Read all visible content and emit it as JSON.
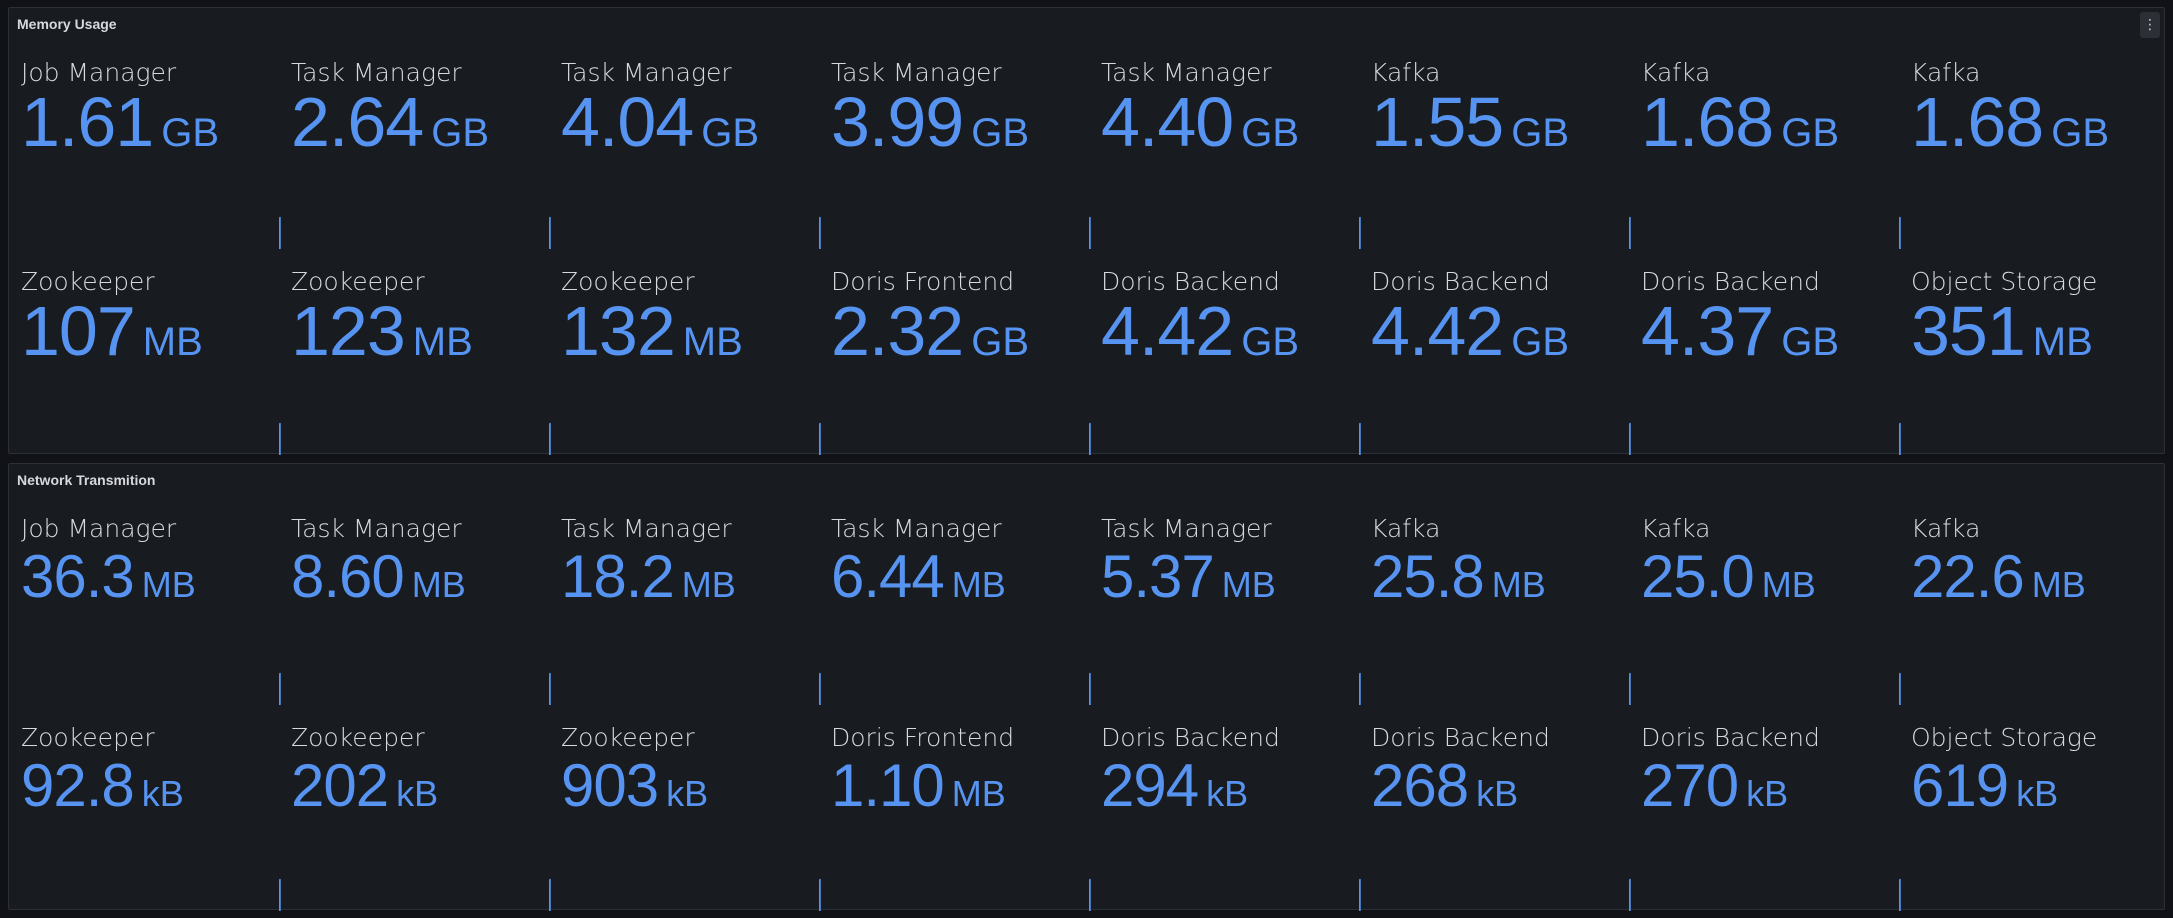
{
  "colors": {
    "value": "#5794f2",
    "background": "#111217",
    "panel": "#181b1f"
  },
  "memory": {
    "title": "Memory Usage",
    "menu_icon": "vertical-ellipsis-icon",
    "stats": [
      {
        "label": "Job Manager",
        "value": "1.61",
        "unit": "GB"
      },
      {
        "label": "Task Manager",
        "value": "2.64",
        "unit": "GB"
      },
      {
        "label": "Task Manager",
        "value": "4.04",
        "unit": "GB"
      },
      {
        "label": "Task Manager",
        "value": "3.99",
        "unit": "GB"
      },
      {
        "label": "Task Manager",
        "value": "4.40",
        "unit": "GB"
      },
      {
        "label": "Kafka",
        "value": "1.55",
        "unit": "GB"
      },
      {
        "label": "Kafka",
        "value": "1.68",
        "unit": "GB"
      },
      {
        "label": "Kafka",
        "value": "1.68",
        "unit": "GB"
      },
      {
        "label": "Zookeeper",
        "value": "107",
        "unit": "MB"
      },
      {
        "label": "Zookeeper",
        "value": "123",
        "unit": "MB"
      },
      {
        "label": "Zookeeper",
        "value": "132",
        "unit": "MB"
      },
      {
        "label": "Doris Frontend",
        "value": "2.32",
        "unit": "GB"
      },
      {
        "label": "Doris Backend",
        "value": "4.42",
        "unit": "GB"
      },
      {
        "label": "Doris Backend",
        "value": "4.42",
        "unit": "GB"
      },
      {
        "label": "Doris Backend",
        "value": "4.37",
        "unit": "GB"
      },
      {
        "label": "Object Storage",
        "value": "351",
        "unit": "MB"
      }
    ]
  },
  "network": {
    "title": "Network Transmition",
    "stats": [
      {
        "label": "Job Manager",
        "value": "36.3",
        "unit": "MB"
      },
      {
        "label": "Task Manager",
        "value": "8.60",
        "unit": "MB"
      },
      {
        "label": "Task Manager",
        "value": "18.2",
        "unit": "MB"
      },
      {
        "label": "Task Manager",
        "value": "6.44",
        "unit": "MB"
      },
      {
        "label": "Task Manager",
        "value": "5.37",
        "unit": "MB"
      },
      {
        "label": "Kafka",
        "value": "25.8",
        "unit": "MB"
      },
      {
        "label": "Kafka",
        "value": "25.0",
        "unit": "MB"
      },
      {
        "label": "Kafka",
        "value": "22.6",
        "unit": "MB"
      },
      {
        "label": "Zookeeper",
        "value": "92.8",
        "unit": "kB"
      },
      {
        "label": "Zookeeper",
        "value": "202",
        "unit": "kB"
      },
      {
        "label": "Zookeeper",
        "value": "903",
        "unit": "kB"
      },
      {
        "label": "Doris Frontend",
        "value": "1.10",
        "unit": "MB"
      },
      {
        "label": "Doris Backend",
        "value": "294",
        "unit": "kB"
      },
      {
        "label": "Doris Backend",
        "value": "268",
        "unit": "kB"
      },
      {
        "label": "Doris Backend",
        "value": "270",
        "unit": "kB"
      },
      {
        "label": "Object Storage",
        "value": "619",
        "unit": "kB"
      }
    ]
  }
}
